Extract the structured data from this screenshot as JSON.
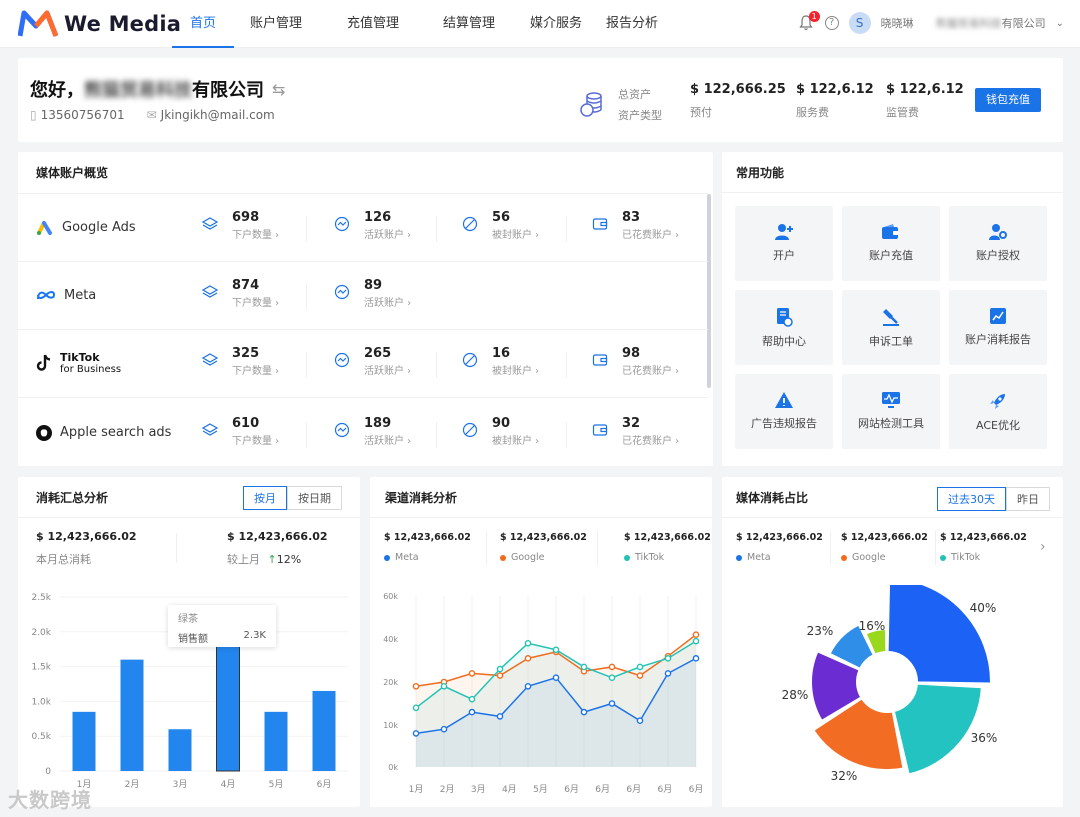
{
  "brand": {
    "name": "We Media"
  },
  "nav": [
    {
      "label": "首页",
      "active": true
    },
    {
      "label": "账户管理"
    },
    {
      "label": "充值管理"
    },
    {
      "label": "结算管理"
    },
    {
      "label": "媒介服务"
    },
    {
      "label": "报告分析"
    }
  ],
  "topbar": {
    "notification_count": "1",
    "help": "?",
    "avatar_initial": "S",
    "username": "晓晓琳",
    "company": "有限公司",
    "company_blurred": "熊猫贸易科技"
  },
  "header": {
    "greeting": "您好，",
    "company_blurred": "熊猫贸易科技",
    "company_suffix": "有限公司",
    "phone": "13560756701",
    "email": "Jkingikh@mail.com",
    "asset_label": "总资产",
    "asset_type_label": "资产类型",
    "assets": [
      {
        "value": "$ 122,666.25",
        "label": "预付"
      },
      {
        "value": "$ 122,6.12",
        "label": "服务费"
      },
      {
        "value": "$ 122,6.12",
        "label": "监管费"
      }
    ],
    "recharge_button": "钱包充值"
  },
  "media_overview": {
    "title": "媒体账户概览",
    "rows": [
      {
        "name": "Google Ads",
        "stats": [
          {
            "value": "698",
            "label": "下户数量 ›"
          },
          {
            "value": "126",
            "label": "活跃账户 ›"
          },
          {
            "value": "56",
            "label": "被封账户 ›"
          },
          {
            "value": "83",
            "label": "已花费账户 ›"
          }
        ]
      },
      {
        "name": "Meta",
        "stats": [
          {
            "value": "874",
            "label": "下户数量 ›"
          },
          {
            "value": "89",
            "label": "活跃账户 ›"
          }
        ]
      },
      {
        "name": "TikTok",
        "name_sub": "for Business",
        "stats": [
          {
            "value": "325",
            "label": "下户数量 ›"
          },
          {
            "value": "265",
            "label": "活跃账户 ›"
          },
          {
            "value": "16",
            "label": "被封账户 ›"
          },
          {
            "value": "98",
            "label": "已花费账户 ›"
          }
        ]
      },
      {
        "name": "Apple search ads",
        "stats": [
          {
            "value": "610",
            "label": "下户数量 ›"
          },
          {
            "value": "189",
            "label": "活跃账户 ›"
          },
          {
            "value": "90",
            "label": "被封账户 ›"
          },
          {
            "value": "32",
            "label": "已花费账户 ›"
          }
        ]
      }
    ]
  },
  "functions": {
    "title": "常用功能",
    "items": [
      {
        "label": "开户",
        "icon": "add-user-icon"
      },
      {
        "label": "账户充值",
        "icon": "wallet-icon"
      },
      {
        "label": "账户授权",
        "icon": "user-key-icon"
      },
      {
        "label": "帮助中心",
        "icon": "help-doc-icon"
      },
      {
        "label": "申诉工单",
        "icon": "gavel-icon"
      },
      {
        "label": "账户消耗报告",
        "icon": "report-chart-icon"
      },
      {
        "label": "广告违规报告",
        "icon": "warning-icon"
      },
      {
        "label": "网站检测工具",
        "icon": "monitor-icon"
      },
      {
        "label": "ACE优化",
        "icon": "rocket-icon"
      }
    ]
  },
  "consumption": {
    "title": "消耗汇总分析",
    "tabs": [
      "按月",
      "按日期"
    ],
    "total": "$ 12,423,666.02",
    "total_label": "本月总消耗",
    "compare": "$ 12,423,666.02",
    "compare_label": "较上月",
    "change": "12%",
    "tooltip": {
      "title": "绿茶",
      "label": "销售额",
      "value": "2.3K"
    }
  },
  "channel": {
    "title": "渠道消耗分析",
    "items": [
      {
        "value": "$ 12,423,666.02",
        "label": "Meta"
      },
      {
        "value": "$ 12,423,666.02",
        "label": "Google"
      },
      {
        "value": "$ 12,423,666.02",
        "label": "TikTok"
      }
    ]
  },
  "share": {
    "title": "媒体消耗占比",
    "tabs": [
      "过去30天",
      "昨日"
    ],
    "items": [
      {
        "value": "$ 12,423,666.02",
        "label": "Meta"
      },
      {
        "value": "$ 12,423,666.02",
        "label": "Google"
      },
      {
        "value": "$ 12,423,666.02",
        "label": "TikTok"
      }
    ]
  },
  "colors": {
    "accent": "#1b73e8",
    "meta": "#1b73e8",
    "google": "#f26b1d",
    "tiktok": "#22c3b4",
    "up": "#2fa84f"
  },
  "watermark": "大数跨境",
  "chart_data": [
    {
      "type": "bar",
      "categories": [
        "1月",
        "2月",
        "3月",
        "4月",
        "5月",
        "6月"
      ],
      "values": [
        850,
        1600,
        600,
        2300,
        850,
        1150
      ],
      "ylim": [
        0,
        2500
      ],
      "yticks": [
        "0",
        "0.5k",
        "1.0k",
        "1.5k",
        "2.0k",
        "2.5k"
      ]
    },
    {
      "type": "line",
      "categories": [
        "1月",
        "2月",
        "3月",
        "4月",
        "5月",
        "6月",
        "6月",
        "6月",
        "6月",
        "6月"
      ],
      "ylim": [
        0,
        60000
      ],
      "yticks": [
        "0k",
        "10k",
        "20k",
        "40k",
        "60k"
      ],
      "series": [
        {
          "name": "Meta",
          "values": [
            8000,
            9000,
            13000,
            12000,
            19000,
            22000,
            13000,
            15000,
            11000,
            24000,
            31000
          ]
        },
        {
          "name": "Google",
          "values": [
            19000,
            20000,
            24000,
            23000,
            31000,
            34000,
            25000,
            27000,
            23000,
            32000,
            42000
          ]
        },
        {
          "name": "TikTok",
          "values": [
            14000,
            19000,
            16000,
            26000,
            38000,
            35000,
            27000,
            22000,
            27000,
            31000,
            39000
          ]
        }
      ]
    },
    {
      "type": "pie",
      "labels": [
        "40%",
        "36%",
        "32%",
        "28%",
        "23%",
        "16%"
      ],
      "values": [
        40,
        36,
        32,
        28,
        23,
        16
      ]
    }
  ]
}
